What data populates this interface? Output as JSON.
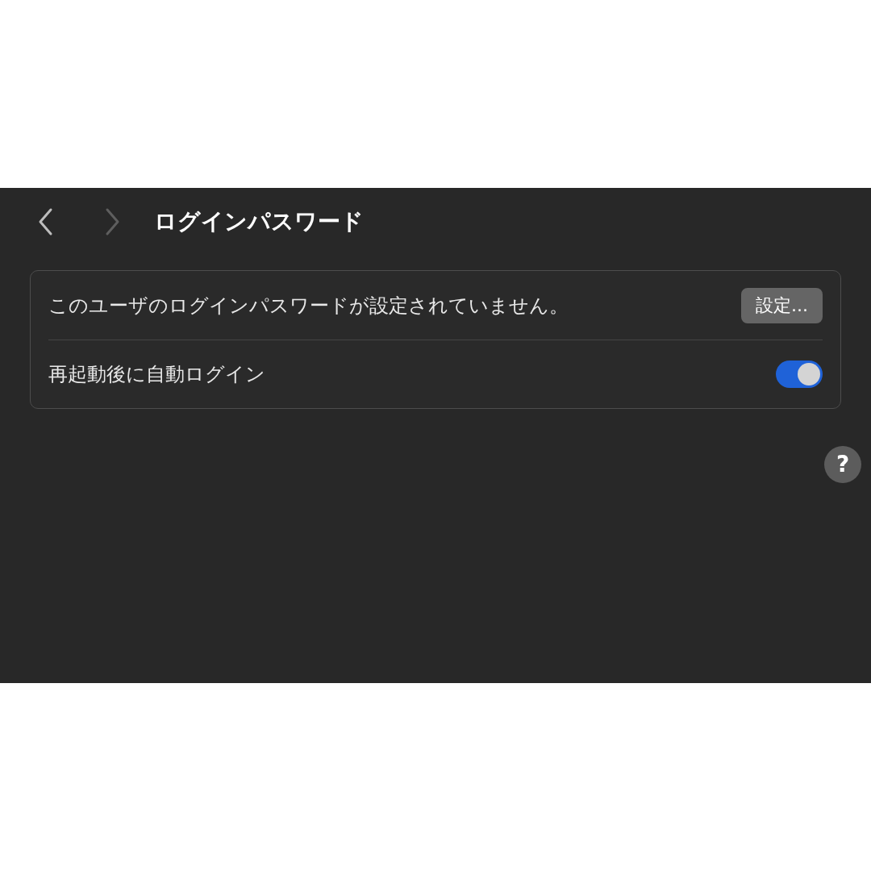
{
  "nav": {
    "back": {
      "disabled": false
    },
    "forward": {
      "disabled": true
    }
  },
  "title": "ログインパスワード",
  "rows": [
    {
      "kind": "button",
      "label": "このユーザのログインパスワードが設定されていません。",
      "button": "設定..."
    },
    {
      "kind": "toggle",
      "label": "再起動後に自動ログイン",
      "on": true
    }
  ],
  "help": "?"
}
